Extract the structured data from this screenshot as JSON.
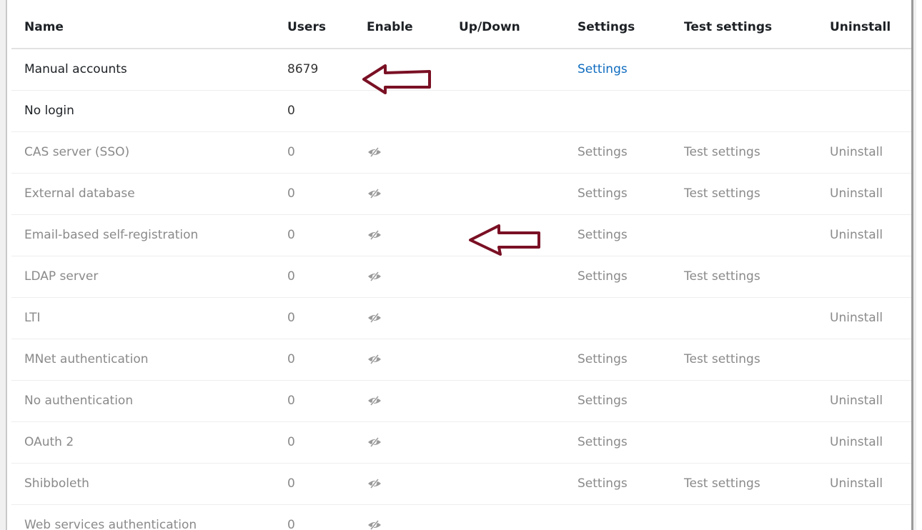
{
  "table": {
    "headers": {
      "name": "Name",
      "users": "Users",
      "enable": "Enable",
      "updown": "Up/Down",
      "settings": "Settings",
      "test": "Test settings",
      "uninstall": "Uninstall"
    },
    "rows": [
      {
        "name": "Manual accounts",
        "users": "8679",
        "settings": "Settings",
        "test": "",
        "uninstall": ""
      },
      {
        "name": "No login",
        "users": "0",
        "settings": "",
        "test": "",
        "uninstall": ""
      },
      {
        "name": "CAS server (SSO)",
        "users": "0",
        "settings": "Settings",
        "test": "Test settings",
        "uninstall": "Uninstall"
      },
      {
        "name": "External database",
        "users": "0",
        "settings": "Settings",
        "test": "Test settings",
        "uninstall": "Uninstall"
      },
      {
        "name": "Email-based self-registration",
        "users": "0",
        "settings": "Settings",
        "test": "",
        "uninstall": "Uninstall"
      },
      {
        "name": "LDAP server",
        "users": "0",
        "settings": "Settings",
        "test": "Test settings",
        "uninstall": ""
      },
      {
        "name": "LTI",
        "users": "0",
        "settings": "",
        "test": "",
        "uninstall": "Uninstall"
      },
      {
        "name": "MNet authentication",
        "users": "0",
        "settings": "Settings",
        "test": "Test settings",
        "uninstall": ""
      },
      {
        "name": "No authentication",
        "users": "0",
        "settings": "Settings",
        "test": "",
        "uninstall": "Uninstall"
      },
      {
        "name": "OAuth 2",
        "users": "0",
        "settings": "Settings",
        "test": "",
        "uninstall": "Uninstall"
      },
      {
        "name": "Shibboleth",
        "users": "0",
        "settings": "Settings",
        "test": "Test settings",
        "uninstall": "Uninstall"
      },
      {
        "name": "Web services authentication",
        "users": "0",
        "settings": "",
        "test": "",
        "uninstall": ""
      }
    ]
  },
  "icons": {
    "enable": "eye-slash-icon",
    "annotation": "red-arrow-left-icon"
  },
  "colors": {
    "link": "#0f6cbf",
    "arrow": "#7a1024",
    "muted_text": "#8a8a8a",
    "header_text": "#1d2125"
  }
}
